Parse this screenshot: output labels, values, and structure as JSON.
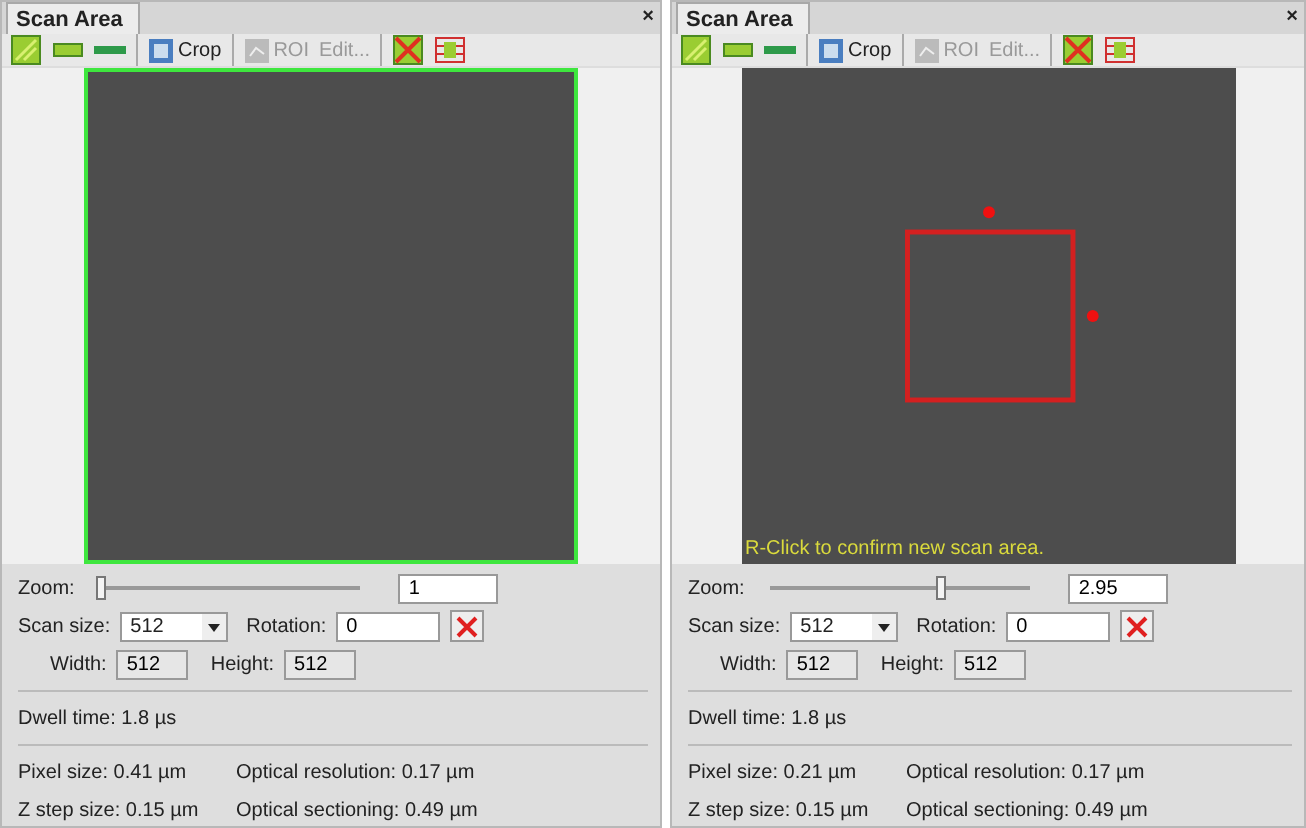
{
  "panels": [
    {
      "tab": "Scan Area",
      "close": "×",
      "toolbar": {
        "crop": "Crop",
        "roi": {
          "label": "ROI",
          "disabled": true
        },
        "edit": {
          "label": "Edit...",
          "disabled": true
        }
      },
      "image": {
        "kind": "full"
      },
      "zoom": {
        "label": "Zoom:",
        "level": 0,
        "value": "1"
      },
      "scan_size": {
        "label": "Scan size:",
        "value": "512"
      },
      "rotation": {
        "label": "Rotation:",
        "value": "0"
      },
      "width": {
        "label": "Width:",
        "value": "512",
        "disabled": true
      },
      "height": {
        "label": "Height:",
        "value": "512",
        "disabled": true
      },
      "dwell_time": "Dwell time: 1.8 µs",
      "pixel_size": "Pixel size: 0.41 µm",
      "optical_resolution": "Optical resolution: 0.17 µm",
      "z_step_size": "Z step size: 0.15 µm",
      "optical_sectioning": "Optical sectioning: 0.49 µm"
    },
    {
      "tab": "Scan Area",
      "close": "×",
      "toolbar": {
        "crop": "Crop",
        "roi": {
          "label": "ROI",
          "disabled": true
        },
        "edit": {
          "label": "Edit...",
          "disabled": true
        }
      },
      "image": {
        "kind": "selection",
        "hint": "R-Click to confirm new scan area."
      },
      "zoom": {
        "label": "Zoom:",
        "level": 0.65,
        "value": "2.95"
      },
      "scan_size": {
        "label": "Scan size:",
        "value": "512"
      },
      "rotation": {
        "label": "Rotation:",
        "value": "0"
      },
      "width": {
        "label": "Width:",
        "value": "512",
        "disabled": true
      },
      "height": {
        "label": "Height:",
        "value": "512",
        "disabled": true
      },
      "dwell_time": "Dwell time: 1.8 µs",
      "pixel_size": "Pixel size: 0.21 µm",
      "optical_resolution": "Optical resolution: 0.17 µm",
      "z_step_size": "Z step size: 0.15 µm",
      "optical_sectioning": "Optical sectioning: 0.49 µm"
    }
  ]
}
